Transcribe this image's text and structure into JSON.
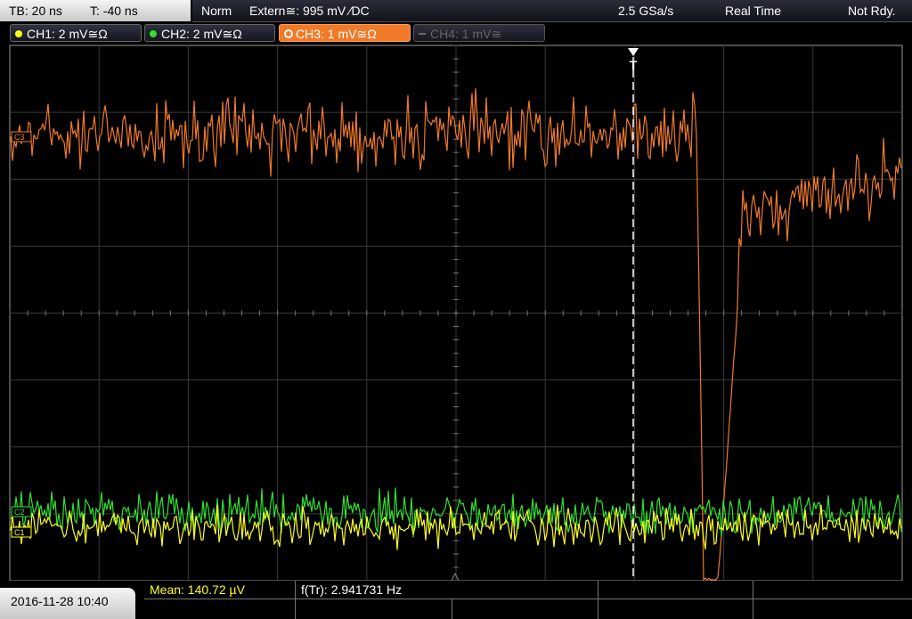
{
  "topbar": {
    "timebase": "TB: 20 ns",
    "trigger_time": "T: -40 ns",
    "trigger_mode": "Norm",
    "trigger_source": "Extern≅: 995 mV ⁄DC",
    "sample_rate": "2.5 GSa/s",
    "acq_mode": "Real Time",
    "status": "Not Rdy."
  },
  "channels": [
    {
      "label": "CH1: 2 mV≅Ω",
      "color": "#ffff20"
    },
    {
      "label": "CH2: 2 mV≅Ω",
      "color": "#30e030"
    },
    {
      "label": "CH3: 1 mV≅Ω",
      "color": "#f07a28"
    },
    {
      "label": "CH4: 1 mV≅",
      "color": "#666666"
    }
  ],
  "markers": {
    "ch3": "C3",
    "ch2": "C2",
    "ch1": "C1",
    "trigger": "T"
  },
  "measurements": {
    "mean": "Mean: 140.72 µV",
    "freq": "f(Tr): 2.941731 Hz"
  },
  "datetime": "2016-11-28 10:40",
  "colors": {
    "grid": "#3a3a3a",
    "frame": "#9a9a9a",
    "ch1": "#ffff20",
    "ch2": "#30e030",
    "ch3": "#f07a28"
  }
}
